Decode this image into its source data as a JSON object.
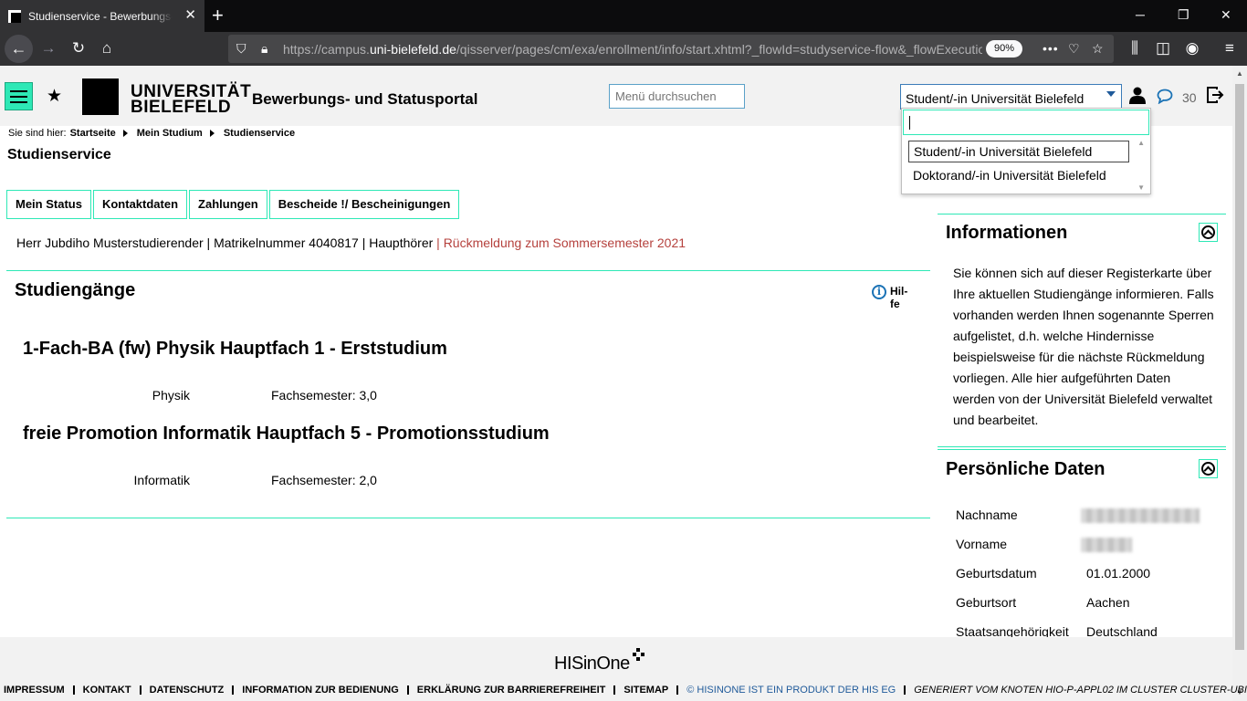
{
  "browser": {
    "tab_title": "Studienservice - Bewerbungs- u",
    "url_prefix": "https://campus.",
    "url_domain": "uni-bielefeld.de",
    "url_rest": "/qisserver/pages/cm/exa/enrollment/info/start.xhtml?_flowId=studyservice-flow&_flowExecutio",
    "zoom": "90%"
  },
  "header": {
    "logo_line1": "UNIVERSITÄT",
    "logo_line2": "BIELEFELD",
    "portal_title": "Bewerbungs- und Statusportal",
    "search_placeholder": "Menü durchsuchen",
    "role_selected": "Student/-in Universität Bielefeld",
    "message_count": "30"
  },
  "role_dropdown": {
    "options": [
      "Student/-in Universität Bielefeld",
      "Doktorand/-in Universität Bielefeld"
    ]
  },
  "breadcrumb": {
    "prefix": "Sie sind hier:",
    "items": [
      "Startseite",
      "Mein Studium",
      "Studienservice"
    ]
  },
  "page_title": "Studienservice",
  "tabs": [
    "Mein Status",
    "Kontaktdaten",
    "Zahlungen",
    "Bescheide !/ Bescheinigungen"
  ],
  "student": {
    "info": "Herr Jubdiho Musterstudierender | Matrikelnummer 4040817 | Haupthörer",
    "alert": "| Rückmeldung zum Sommersemester 2021"
  },
  "studies": {
    "title": "Studiengänge",
    "help_label": "Hil-fe",
    "courses": [
      {
        "title": "1-Fach-BA (fw) Physik Hauptfach 1 - Erststudium",
        "subject": "Physik",
        "semester": "Fachsemester: 3,0"
      },
      {
        "title": "freie Promotion Informatik Hauptfach 5 - Promotionsstudium",
        "subject": "Informatik",
        "semester": "Fachsemester: 2,0"
      }
    ]
  },
  "info_panel": {
    "title": "Informationen",
    "text": "Sie können sich auf dieser Registerkarte über Ihre aktuellen Studiengänge informieren. Falls vorhanden werden Ihnen sogenannte Sperren aufgelistet, d.h. welche Hindernisse beispielsweise für die nächste Rückmeldung vorliegen. Alle hier aufgeführten Daten werden von der Universität Bielefeld verwaltet und bearbeitet."
  },
  "personal_panel": {
    "title": "Persönliche Daten",
    "rows": [
      {
        "label": "Nachname",
        "value": ""
      },
      {
        "label": "Vorname",
        "value": ""
      },
      {
        "label": "Geburtsdatum",
        "value": "01.01.2000"
      },
      {
        "label": "Geburtsort",
        "value": "Aachen"
      },
      {
        "label": "Staatsangehörigkeit",
        "value": "Deutschland"
      }
    ]
  },
  "footer": {
    "logo": "HISinOne",
    "links": [
      "IMPRESSUM",
      "KONTAKT",
      "DATENSCHUTZ",
      "INFORMATION ZUR BEDIENUNG",
      "ERKLÄRUNG ZUR BARRIEREFREIHEIT",
      "SITEMAP"
    ],
    "copyright": "© HISINONE IST EIN PRODUKT DER HIS EG",
    "generated": "GENERIERT VOM KNOTEN HIO-P-APPL02 IM CLUSTER CLUSTER-UBI-P."
  },
  "colors": {
    "accent": "#2ee8b6",
    "alert": "#b5413d",
    "link": "#1f5a9a"
  }
}
